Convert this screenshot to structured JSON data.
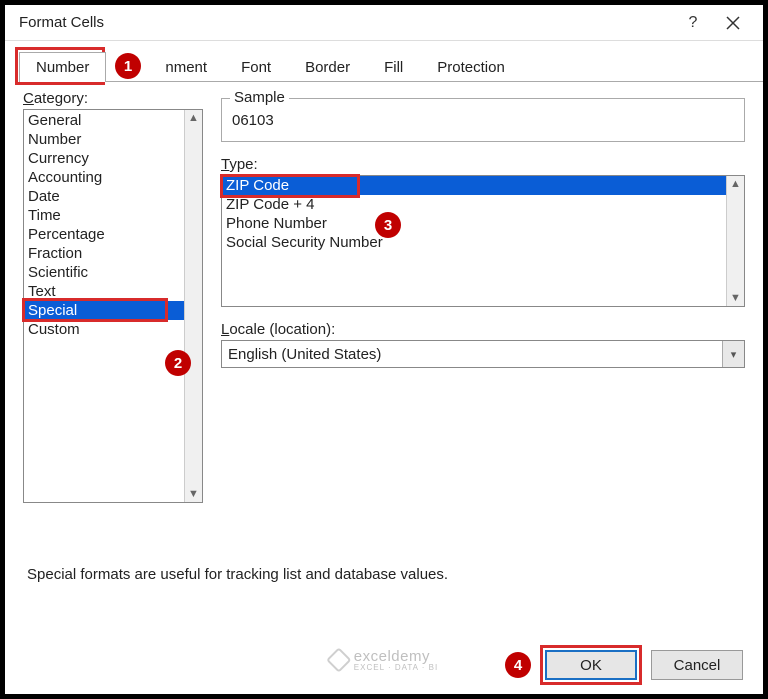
{
  "window": {
    "title": "Format Cells"
  },
  "tabs": [
    "Number",
    "Alignment",
    "Font",
    "Border",
    "Fill",
    "Protection"
  ],
  "tabs_display": {
    "alignment_clipped": "nment"
  },
  "category": {
    "label": "Category:",
    "items": [
      "General",
      "Number",
      "Currency",
      "Accounting",
      "Date",
      "Time",
      "Percentage",
      "Fraction",
      "Scientific",
      "Text",
      "Special",
      "Custom"
    ],
    "selected": "Special"
  },
  "sample": {
    "label": "Sample",
    "value": "06103"
  },
  "type": {
    "label": "Type:",
    "items": [
      "ZIP Code",
      "ZIP Code + 4",
      "Phone Number",
      "Social Security Number"
    ],
    "selected": "ZIP Code"
  },
  "locale": {
    "label": "Locale (location):",
    "value": "English (United States)"
  },
  "description": "Special formats are useful for tracking list and database values.",
  "buttons": {
    "ok": "OK",
    "cancel": "Cancel"
  },
  "annotations": {
    "marker1": "1",
    "marker2": "2",
    "marker3": "3",
    "marker4": "4"
  },
  "watermark": {
    "brand": "exceldemy",
    "tagline": "EXCEL · DATA · BI"
  }
}
